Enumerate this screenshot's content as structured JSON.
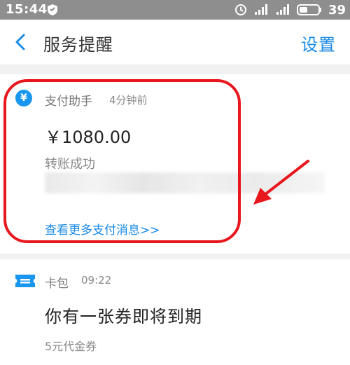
{
  "statusbar": {
    "time": "15:44",
    "battery": "39",
    "icons": [
      "shield-icon",
      "alarm-icon",
      "signal-icon",
      "signal-icon",
      "battery-icon"
    ]
  },
  "header": {
    "title": "服务提醒",
    "settings_label": "设置",
    "back_icon": "chevron-left-icon"
  },
  "payment_card": {
    "source_name": "支付助手",
    "time": "4分钟前",
    "amount": "￥1080.00",
    "status": "转账成功",
    "more_link": "查看更多支付消息>>",
    "icon_glyph": "¥",
    "icon_color": "#1896f0"
  },
  "card_pack": {
    "source_name": "卡包",
    "time": "09:22",
    "headline": "你有一张券即将到期",
    "subline": "5元代金券",
    "icon": "ticket-icon"
  },
  "colors": {
    "accent": "#1a8ae6",
    "annotation": "#e8171d",
    "statusbar": "#8e8e8e"
  }
}
